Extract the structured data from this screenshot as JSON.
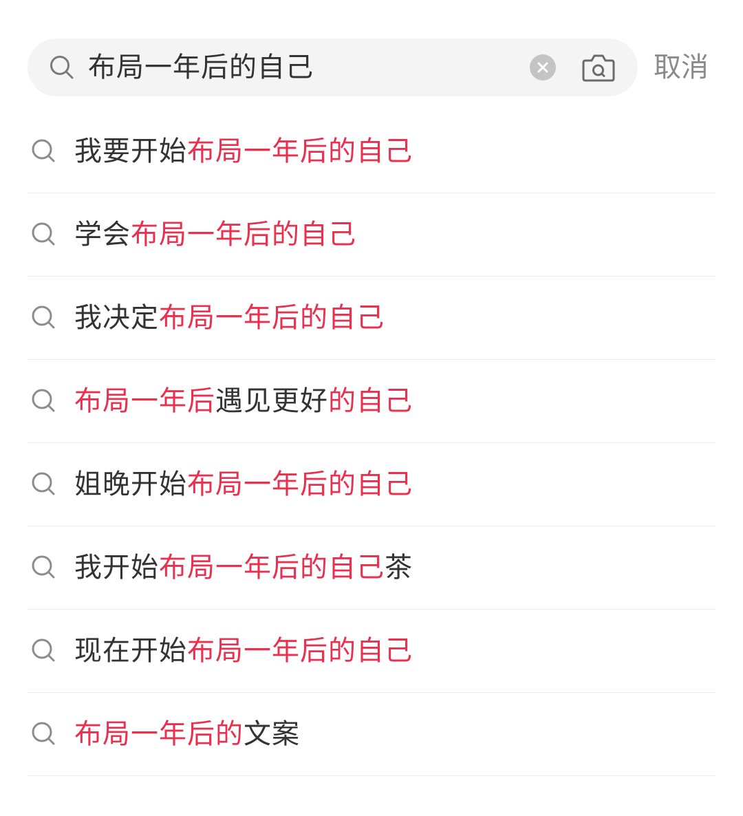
{
  "search": {
    "query": "布局一年后的自己",
    "cancel_label": "取消"
  },
  "colors": {
    "highlight": "#e8314f",
    "text": "#333333",
    "muted": "#8a8a8a",
    "search_bg": "#f4f4f4"
  },
  "icons": {
    "search": "search-icon",
    "clear": "clear-icon",
    "camera": "camera-scan-icon"
  },
  "suggestions": [
    {
      "segments": [
        {
          "text": "我要开始",
          "highlight": false
        },
        {
          "text": "布局一年后的自己",
          "highlight": true
        }
      ]
    },
    {
      "segments": [
        {
          "text": "学会",
          "highlight": false
        },
        {
          "text": "布局一年后的自己",
          "highlight": true
        }
      ]
    },
    {
      "segments": [
        {
          "text": "我决定",
          "highlight": false
        },
        {
          "text": "布局一年后的自己",
          "highlight": true
        }
      ]
    },
    {
      "segments": [
        {
          "text": "布局一年后",
          "highlight": true
        },
        {
          "text": "遇见更好",
          "highlight": false
        },
        {
          "text": "的自己",
          "highlight": true
        }
      ]
    },
    {
      "segments": [
        {
          "text": "姐晚开始",
          "highlight": false
        },
        {
          "text": "布局一年后的自己",
          "highlight": true
        }
      ]
    },
    {
      "segments": [
        {
          "text": "我开始",
          "highlight": false
        },
        {
          "text": "布局一年后的自己",
          "highlight": true
        },
        {
          "text": "茶",
          "highlight": false
        }
      ]
    },
    {
      "segments": [
        {
          "text": "现在开始",
          "highlight": false
        },
        {
          "text": "布局一年后的自己",
          "highlight": true
        }
      ]
    },
    {
      "segments": [
        {
          "text": "布局一年后的",
          "highlight": true
        },
        {
          "text": "文案",
          "highlight": false
        }
      ]
    }
  ]
}
